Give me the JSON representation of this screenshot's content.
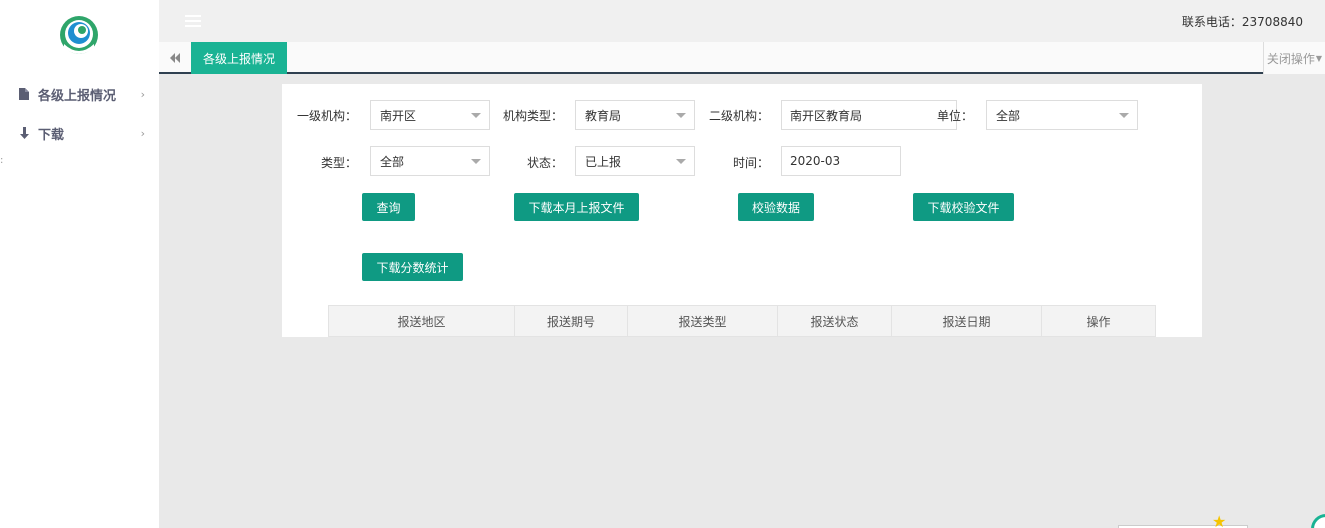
{
  "sidebar": {
    "items": [
      {
        "label": "各级上报情况",
        "icon": "file-icon"
      },
      {
        "label": "下载",
        "icon": "arrow-down-icon"
      }
    ]
  },
  "header": {
    "contact": "联系电话：23708840"
  },
  "tabs": {
    "active_label": "各级上报情况",
    "close_ops_label": "关闭操作"
  },
  "filters": {
    "level1": {
      "label": "一级机构：",
      "value": "南开区"
    },
    "org_type": {
      "label": "机构类型：",
      "value": "教育局"
    },
    "level2": {
      "label": "二级机构：",
      "value": "南开区教育局"
    },
    "unit": {
      "label": "单位：",
      "value": "全部"
    },
    "type": {
      "label": "类型：",
      "value": "全部"
    },
    "status": {
      "label": "状态：",
      "value": "已上报"
    },
    "time": {
      "label": "时间：",
      "value": "2020-03"
    }
  },
  "buttons": {
    "query": "查询",
    "download_month": "下载本月上报文件",
    "verify": "校验数据",
    "download_verify": "下载校验文件",
    "download_stats": "下载分数统计"
  },
  "table": {
    "columns": [
      "报送地区",
      "报送期号",
      "报送类型",
      "报送状态",
      "报送日期",
      "操作"
    ]
  },
  "colors": {
    "accent": "#1ab394",
    "button": "#0f9a83",
    "tab_underline": "#2f4050"
  }
}
